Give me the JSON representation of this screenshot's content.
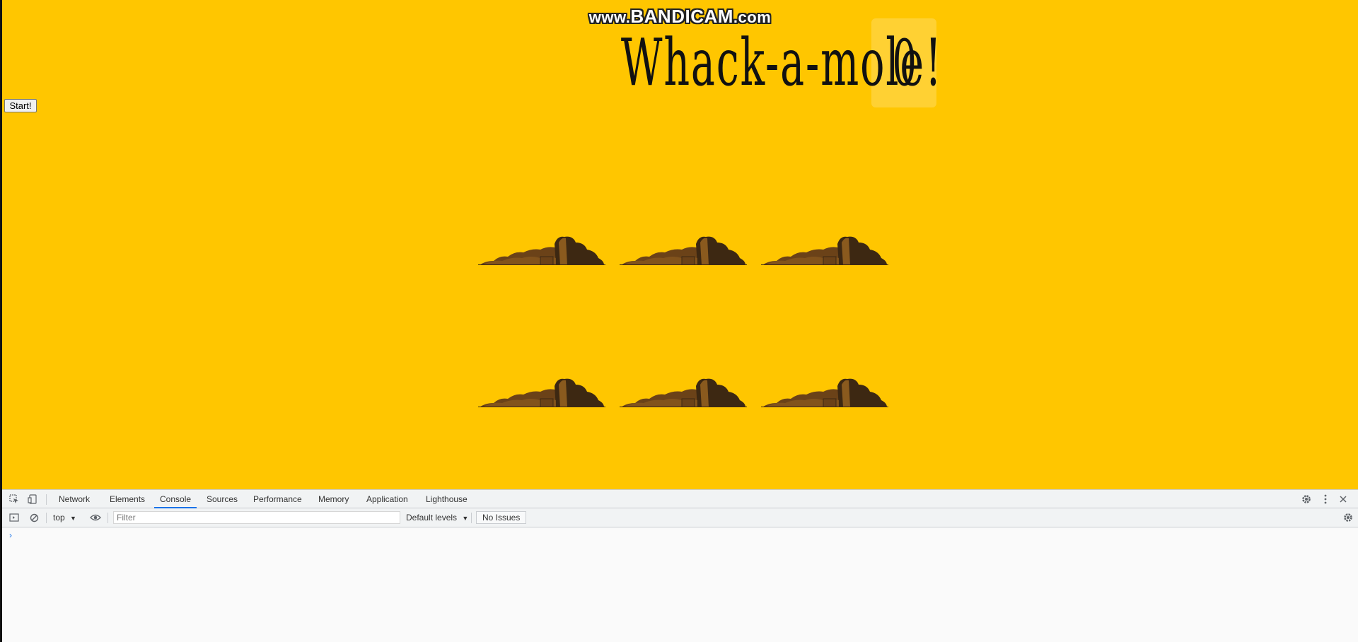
{
  "watermark": {
    "prefix": "www.",
    "brand": "BANDICAM",
    "suffix": ".com"
  },
  "game": {
    "title": "Whack-a-mole!",
    "score": "0",
    "start_label": "Start!",
    "hole_count": 6
  },
  "colors": {
    "background": "#ffc600",
    "dirt_dark": "#3d2812",
    "dirt_mid": "#6b4218",
    "dirt_light": "#8a5a1e",
    "devtools_bg": "#f1f3f4",
    "accent": "#1a73e8"
  },
  "devtools": {
    "tabs": [
      {
        "label": "Network"
      },
      {
        "label": "Elements"
      },
      {
        "label": "Console"
      },
      {
        "label": "Sources"
      },
      {
        "label": "Performance"
      },
      {
        "label": "Memory"
      },
      {
        "label": "Application"
      },
      {
        "label": "Lighthouse"
      }
    ],
    "active_tab": "Console",
    "context": "top",
    "filter_placeholder": "Filter",
    "levels": "Default levels",
    "issues": "No Issues",
    "prompt": "›",
    "icons": {
      "inspect": "inspect-element-icon",
      "device": "device-toolbar-icon",
      "settings": "gear-icon",
      "more": "more-vert-icon",
      "close": "close-icon",
      "sidebar": "console-sidebar-icon",
      "clear": "clear-console-icon",
      "eye": "live-expression-icon",
      "console_settings": "console-settings-gear-icon"
    }
  }
}
